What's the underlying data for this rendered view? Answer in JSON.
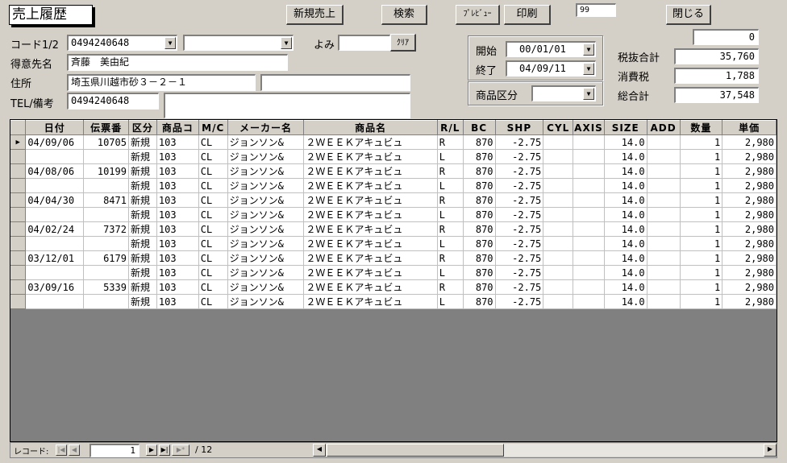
{
  "window": {
    "title": "売上履歴"
  },
  "toolbar": {
    "new_sale": "新規売上",
    "search": "検索",
    "preview": "ﾌﾟﾚﾋﾞｭｰ",
    "print": "印刷",
    "print_copies": "99",
    "close": "閉じる"
  },
  "form": {
    "code_label": "コード1/2",
    "code1": "0494240648",
    "code2": "",
    "yomi_label": "よみ",
    "yomi_value": "",
    "clear_button": "ｸﾘｱ",
    "customer_label": "得意先名",
    "customer_name": "斉藤　美由紀",
    "address_label": "住所",
    "address1": "埼玉県川越市砂３－２－１",
    "address2": "",
    "tel_label": "TEL/備考",
    "tel": "0494240648",
    "memo": ""
  },
  "period": {
    "start_label": "開始",
    "start_value": "00/01/01",
    "end_label": "終了",
    "end_value": "04/09/11",
    "category_label": "商品区分",
    "category_value": ""
  },
  "totals": {
    "top_value": "0",
    "subtotal_label": "税抜合計",
    "subtotal": "35,760",
    "tax_label": "消費税",
    "tax": "1,788",
    "total_label": "総合計",
    "total": "37,548"
  },
  "table": {
    "columns": [
      "日付",
      "伝票番",
      "区分",
      "商品コ",
      "M/C",
      "メーカー名",
      "商品名",
      "R/L",
      "BC",
      "SHP",
      "CYL",
      "AXIS",
      "SIZE",
      "ADD",
      "数量",
      "単価"
    ],
    "rows": [
      [
        "04/09/06",
        "10705",
        "新規",
        "103",
        "CL",
        "ジョンソン&",
        "２ＷＥＥＫアキュビュ",
        "R",
        "870",
        "-2.75",
        "",
        "",
        "14.0",
        "",
        "1",
        "2,980"
      ],
      [
        "",
        "",
        "新規",
        "103",
        "CL",
        "ジョンソン&",
        "２ＷＥＥＫアキュビュ",
        "L",
        "870",
        "-2.75",
        "",
        "",
        "14.0",
        "",
        "1",
        "2,980"
      ],
      [
        "04/08/06",
        "10199",
        "新規",
        "103",
        "CL",
        "ジョンソン&",
        "２ＷＥＥＫアキュビュ",
        "R",
        "870",
        "-2.75",
        "",
        "",
        "14.0",
        "",
        "1",
        "2,980"
      ],
      [
        "",
        "",
        "新規",
        "103",
        "CL",
        "ジョンソン&",
        "２ＷＥＥＫアキュビュ",
        "L",
        "870",
        "-2.75",
        "",
        "",
        "14.0",
        "",
        "1",
        "2,980"
      ],
      [
        "04/04/30",
        "8471",
        "新規",
        "103",
        "CL",
        "ジョンソン&",
        "２ＷＥＥＫアキュビュ",
        "R",
        "870",
        "-2.75",
        "",
        "",
        "14.0",
        "",
        "1",
        "2,980"
      ],
      [
        "",
        "",
        "新規",
        "103",
        "CL",
        "ジョンソン&",
        "２ＷＥＥＫアキュビュ",
        "L",
        "870",
        "-2.75",
        "",
        "",
        "14.0",
        "",
        "1",
        "2,980"
      ],
      [
        "04/02/24",
        "7372",
        "新規",
        "103",
        "CL",
        "ジョンソン&",
        "２ＷＥＥＫアキュビュ",
        "R",
        "870",
        "-2.75",
        "",
        "",
        "14.0",
        "",
        "1",
        "2,980"
      ],
      [
        "",
        "",
        "新規",
        "103",
        "CL",
        "ジョンソン&",
        "２ＷＥＥＫアキュビュ",
        "L",
        "870",
        "-2.75",
        "",
        "",
        "14.0",
        "",
        "1",
        "2,980"
      ],
      [
        "03/12/01",
        "6179",
        "新規",
        "103",
        "CL",
        "ジョンソン&",
        "２ＷＥＥＫアキュビュ",
        "R",
        "870",
        "-2.75",
        "",
        "",
        "14.0",
        "",
        "1",
        "2,980"
      ],
      [
        "",
        "",
        "新規",
        "103",
        "CL",
        "ジョンソン&",
        "２ＷＥＥＫアキュビュ",
        "L",
        "870",
        "-2.75",
        "",
        "",
        "14.0",
        "",
        "1",
        "2,980"
      ],
      [
        "03/09/16",
        "5339",
        "新規",
        "103",
        "CL",
        "ジョンソン&",
        "２ＷＥＥＫアキュビュ",
        "R",
        "870",
        "-2.75",
        "",
        "",
        "14.0",
        "",
        "1",
        "2,980"
      ],
      [
        "",
        "",
        "新規",
        "103",
        "CL",
        "ジョンソン&",
        "２ＷＥＥＫアキュビュ",
        "L",
        "870",
        "-2.75",
        "",
        "",
        "14.0",
        "",
        "1",
        "2,980"
      ]
    ]
  },
  "navigation": {
    "record_label": "レコード:",
    "current": "1",
    "total_label": "/ 12",
    "first_icon": "first-record-icon",
    "prev_icon": "prev-record-icon",
    "next_icon": "next-record-icon",
    "last_icon": "last-record-icon",
    "new_icon": "new-record-icon"
  },
  "colors": {
    "form_bg": "#d4d0c8",
    "grid_bg": "#808080",
    "field_bg": "#ffffff"
  }
}
